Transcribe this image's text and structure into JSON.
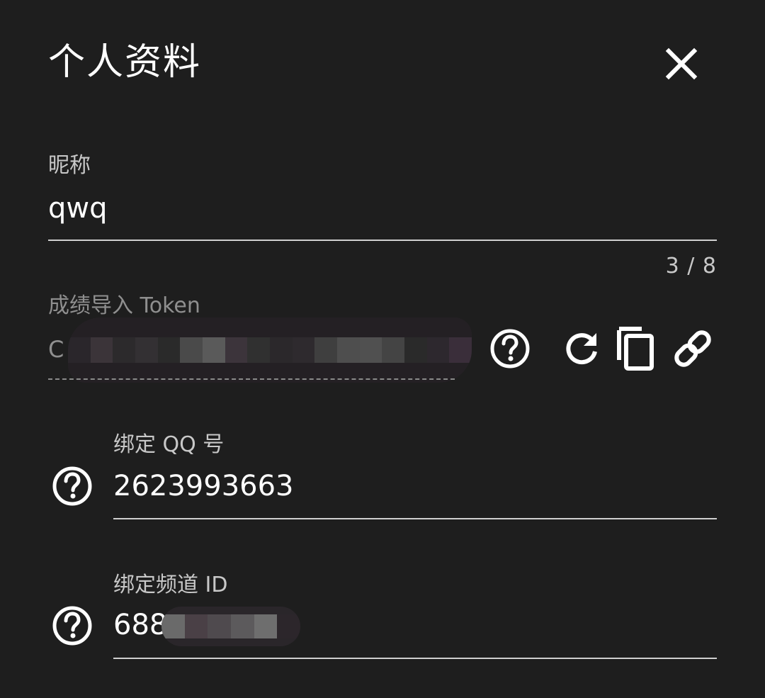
{
  "dialog": {
    "title": "个人资料",
    "close_icon": "close-icon"
  },
  "nickname": {
    "label": "昵称",
    "value": "qwq",
    "counter": "3 / 8"
  },
  "token": {
    "label": "成绩导入 Token",
    "value_visible_prefix": "C",
    "icons": [
      "help-circle-icon",
      "refresh-icon",
      "copy-icon",
      "link-icon"
    ]
  },
  "qq": {
    "label": "绑定 QQ 号",
    "value": "2623993663",
    "help_icon": "help-circle-icon"
  },
  "channel": {
    "label": "绑定频道 ID",
    "value_visible_prefix": "688",
    "help_icon": "help-circle-icon"
  },
  "colors": {
    "background": "#1e1e1e",
    "text_primary": "#ffffff",
    "text_secondary": "#c8c8c8",
    "text_disabled": "#8f8f8f",
    "underline": "#d0d0d0"
  }
}
